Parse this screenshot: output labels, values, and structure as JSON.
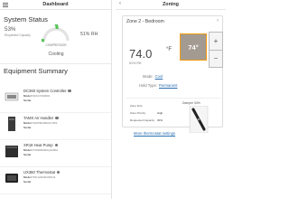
{
  "dashboard": {
    "title": "Dashboard",
    "system_status": {
      "heading": "System Status",
      "capacity_value": "53%",
      "capacity_label": "Requested Capacity",
      "compressor_label": "COMPRESSOR",
      "humidity": "51% RH",
      "mode": "Cooling"
    },
    "equipment": {
      "heading": "Equipment Summary",
      "items": [
        {
          "name": "DC360 System Controller",
          "model_label": "Model",
          "model": "SR1G7200001",
          "serial_label": "Serial",
          "serial": ""
        },
        {
          "name": "TAMX Air Handler",
          "model_label": "Model",
          "model": "TAMX9D1BAH3.0SS",
          "serial_label": "Serial",
          "serial": ""
        },
        {
          "name": "XR18 Heat Pump",
          "model_label": "Model",
          "model": "4TWR9D36AQ1000A",
          "serial_label": "Serial",
          "serial": ""
        },
        {
          "name": "UX360 Thermostat",
          "model_label": "Model",
          "model": "TSK1220301W4C6",
          "serial_label": "Serial",
          "serial": ""
        }
      ]
    }
  },
  "zoning": {
    "title": "Zoning",
    "zone_name": "Zone 2 - Bedroom",
    "current_temp": "74.0",
    "temp_unit": "°F",
    "humidity": "51% RH",
    "setpoint": "74°",
    "mode_label": "Mode:",
    "mode_value": "Cool",
    "hold_label": "Hold Type:",
    "hold_value": "Permanent",
    "damper_label": "Damper 34%",
    "damper_level_percent": 34,
    "stats": [
      {
        "label": "Zone Size",
        "value": ""
      },
      {
        "label": "Zone Priority",
        "value": "High"
      },
      {
        "label": "Requested Capacity",
        "value": "30%"
      }
    ],
    "more_link": "More thermostat settings"
  },
  "colors": {
    "accent": "#f39c12",
    "setpoint_bg": "#a39b91",
    "link": "#2a6fb0",
    "gauge_green": "#59c45a"
  }
}
